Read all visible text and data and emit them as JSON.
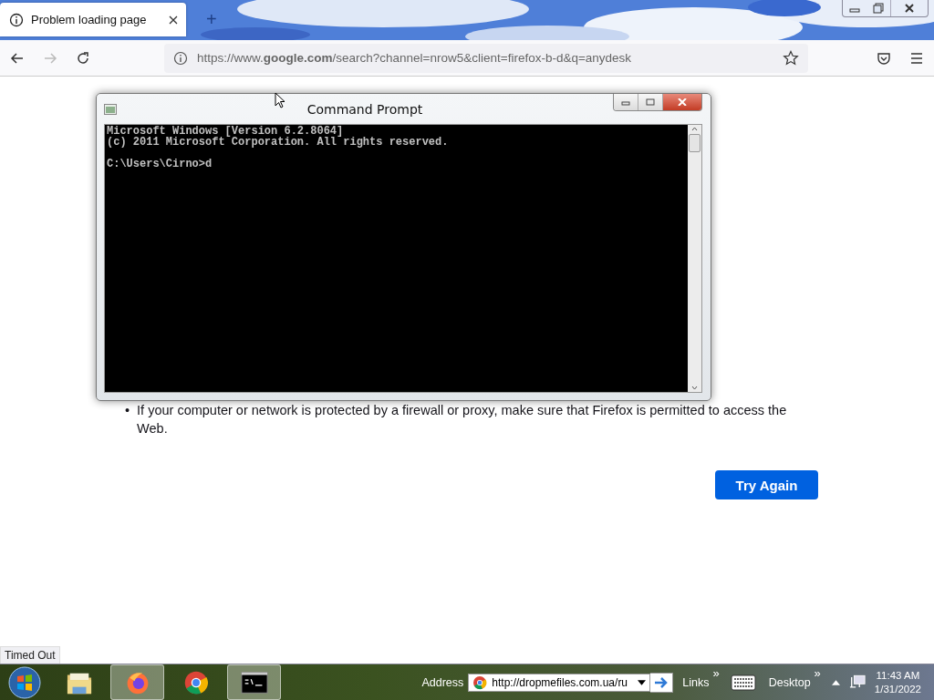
{
  "tabs": [
    {
      "title": "Problem loading page",
      "selected": true
    }
  ],
  "new_tab": "+",
  "address_bar": {
    "url": "https://www.**google.com**/search?channel=nrow5&client=firefox-b-d&q=anydesk"
  },
  "page": {
    "marker": "•",
    "bullet": "If your computer or network is protected by a firewall or proxy, make sure that Firefox is permitted to access the Web.",
    "button": "Try Again"
  },
  "status": "Timed Out",
  "console_window": {
    "title": "Command Prompt",
    "output_lines": [
      "Microsoft Windows [Version 6.2.8064]",
      "(c) 2011 Microsoft Corporation. All rights reserved."
    ],
    "prompt": "C:\\Users\\Cirno>d"
  },
  "taskbar": {
    "apps": [
      {
        "kind": "explorer",
        "active": false
      },
      {
        "kind": "firefox",
        "active": true
      },
      {
        "kind": "chrome",
        "active": false
      },
      {
        "kind": "console",
        "active": true
      }
    ],
    "address_label": "Address",
    "address_value": "http://dropmefiles.com.ua/ru",
    "links": "Links",
    "more": "»",
    "desktop": "Desktop",
    "desktop_more": "»",
    "time": "11:43 AM",
    "date": "1/31/2022"
  }
}
